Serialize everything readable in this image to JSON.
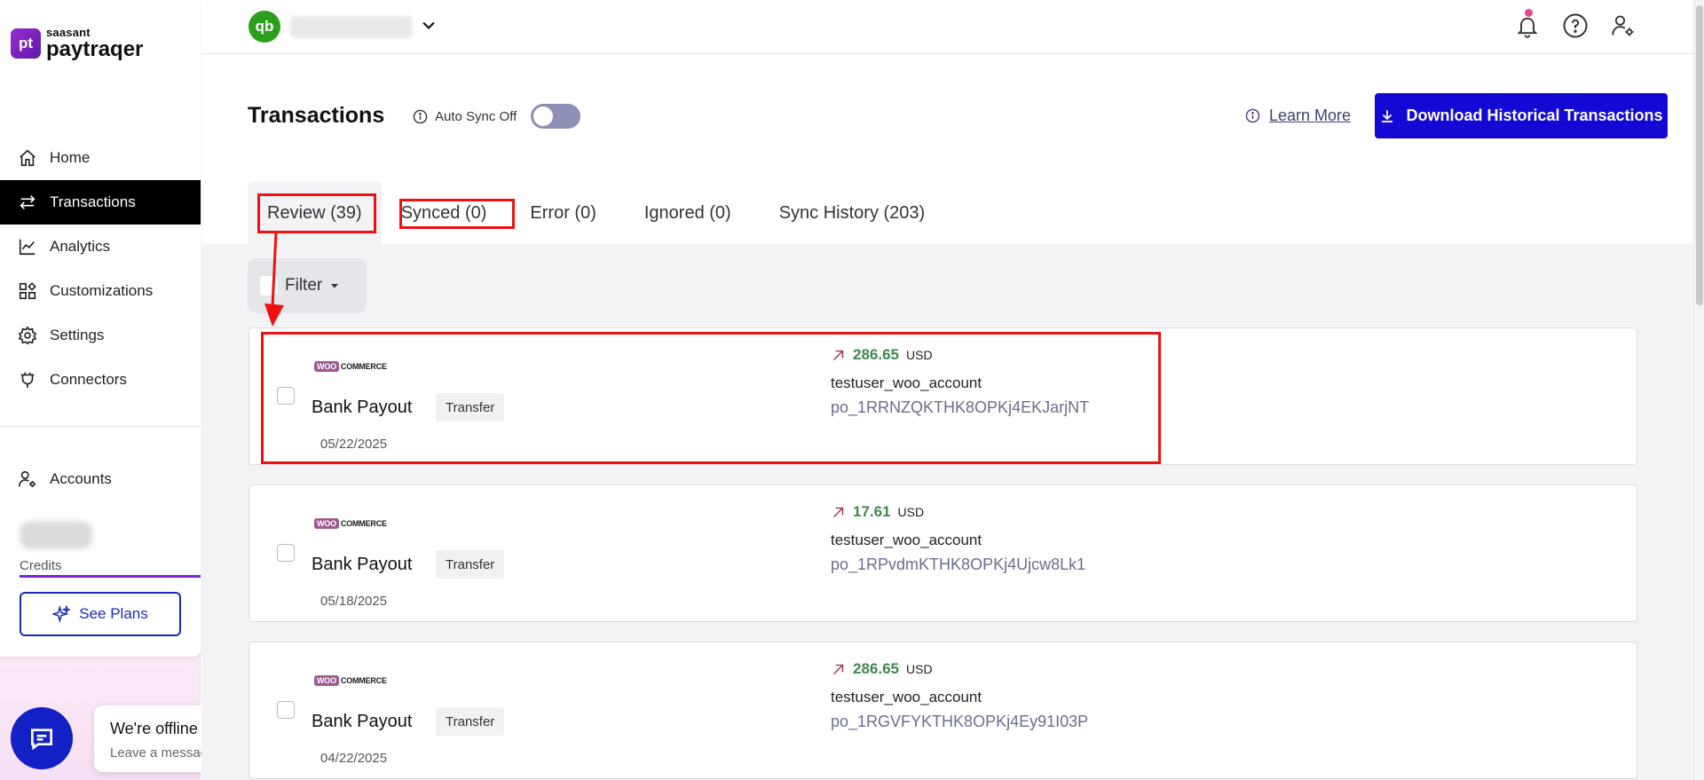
{
  "brand": {
    "small": "saasant",
    "big": "paytraqer",
    "mark": "pt"
  },
  "sidebar": {
    "items": [
      {
        "label": "Home",
        "icon": "home-icon"
      },
      {
        "label": "Transactions",
        "icon": "transfer-arrows-icon"
      },
      {
        "label": "Analytics",
        "icon": "chart-line-icon"
      },
      {
        "label": "Customizations",
        "icon": "widgets-icon"
      },
      {
        "label": "Settings",
        "icon": "gear-icon"
      },
      {
        "label": "Connectors",
        "icon": "plug-icon"
      }
    ],
    "accounts_label": "Accounts",
    "credits_label": "Credits",
    "see_plans_label": "See Plans"
  },
  "chat": {
    "title": "We're offline",
    "subtitle": "Leave a message"
  },
  "topbar": {
    "qb_mark": "qb"
  },
  "page": {
    "title": "Transactions",
    "autosync_label": "Auto Sync Off",
    "learn_more": "Learn More",
    "download_label": "Download Historical Transactions"
  },
  "tabs": [
    {
      "label": "Review (39)"
    },
    {
      "label": "Synced (0)"
    },
    {
      "label": "Error (0)"
    },
    {
      "label": "Ignored (0)"
    },
    {
      "label": "Sync History (203)"
    }
  ],
  "filter": {
    "label": "Filter"
  },
  "transactions": [
    {
      "source": "COMMERCE",
      "source_mark": "WOO",
      "title": "Bank Payout",
      "type": "Transfer",
      "date": "05/22/2025",
      "amount": "286.65",
      "currency": "USD",
      "account": "testuser_woo_account",
      "ref": "po_1RRNZQKTHK8OPKj4EKJarjNT"
    },
    {
      "source": "COMMERCE",
      "source_mark": "WOO",
      "title": "Bank Payout",
      "type": "Transfer",
      "date": "05/18/2025",
      "amount": "17.61",
      "currency": "USD",
      "account": "testuser_woo_account",
      "ref": "po_1RPvdmKTHK8OPKj4Ujcw8Lk1"
    },
    {
      "source": "COMMERCE",
      "source_mark": "WOO",
      "title": "Bank Payout",
      "type": "Transfer",
      "date": "04/22/2025",
      "amount": "286.65",
      "currency": "USD",
      "account": "testuser_woo_account",
      "ref": "po_1RGVFYKTHK8OPKj4Ey91I03P"
    }
  ],
  "colors": {
    "primary": "#1408d4",
    "amount_green": "#3d8a4d",
    "highlight_red": "#ef1111",
    "brand_purple": "#7b21d8"
  }
}
